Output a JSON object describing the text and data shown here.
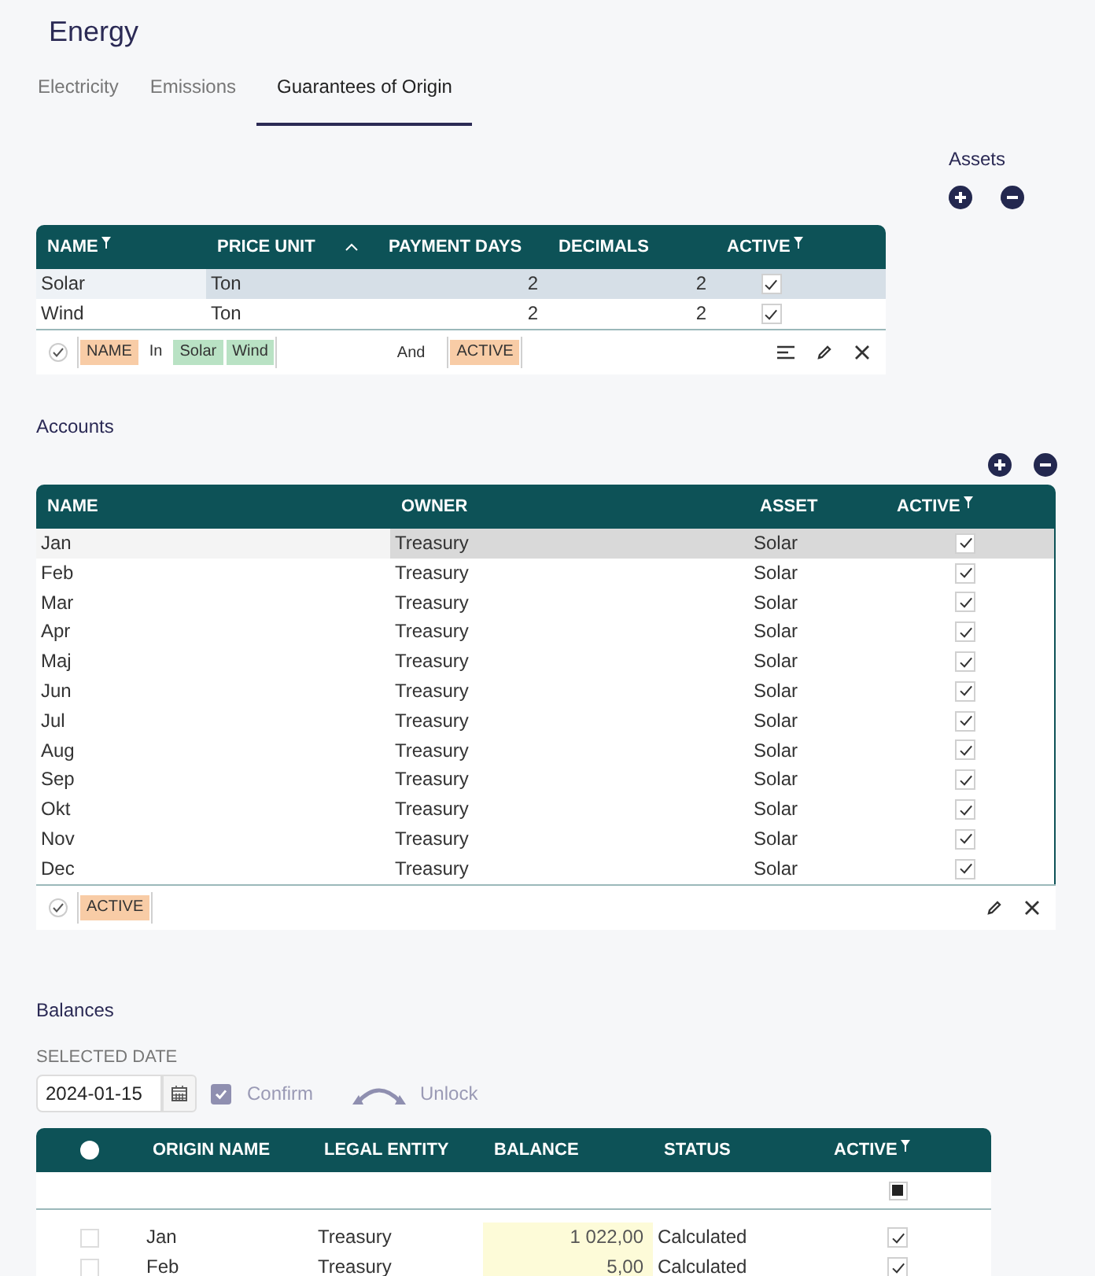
{
  "page_title": "Energy",
  "tabs": [
    {
      "label": "Electricity",
      "selected": false
    },
    {
      "label": "Emissions",
      "selected": false
    },
    {
      "label": "Guarantees of Origin",
      "selected": true
    }
  ],
  "assets": {
    "title": "Assets",
    "columns": [
      {
        "label": "NAME",
        "filter": true,
        "sorted": false
      },
      {
        "label": "PRICE UNIT",
        "filter": false,
        "sorted": true
      },
      {
        "label": "PAYMENT DAYS",
        "filter": false,
        "sorted": false
      },
      {
        "label": "DECIMALS",
        "filter": false,
        "sorted": false
      },
      {
        "label": "ACTIVE",
        "filter": true,
        "sorted": false
      }
    ],
    "rows": [
      {
        "cells": [
          "Solar",
          "Ton",
          "2",
          "2"
        ],
        "active": true,
        "selected": true
      },
      {
        "cells": [
          "Wind",
          "Ton",
          "2",
          "2"
        ],
        "active": true,
        "selected": false
      }
    ],
    "filter": {
      "enabled": true,
      "groups": [
        {
          "tokens": [
            {
              "kind": "field",
              "text": "NAME"
            },
            {
              "kind": "op",
              "text": "In"
            },
            {
              "kind": "value",
              "text": "Solar"
            },
            {
              "kind": "value",
              "text": "Wind"
            }
          ]
        },
        {
          "connector": "And",
          "tokens": [
            {
              "kind": "field",
              "text": "ACTIVE"
            }
          ]
        }
      ]
    }
  },
  "accounts": {
    "title": "Accounts",
    "columns": [
      {
        "label": "NAME",
        "filter": false,
        "sorted": false
      },
      {
        "label": "OWNER",
        "filter": false,
        "sorted": false
      },
      {
        "label": "ASSET",
        "filter": false,
        "sorted": false
      },
      {
        "label": "ACTIVE",
        "filter": true,
        "sorted": false
      }
    ],
    "rows": [
      {
        "cells": [
          "Jan",
          "Treasury",
          "Solar"
        ],
        "active": true,
        "selected": true
      },
      {
        "cells": [
          "Feb",
          "Treasury",
          "Solar"
        ],
        "active": true,
        "selected": false
      },
      {
        "cells": [
          "Mar",
          "Treasury",
          "Solar"
        ],
        "active": true,
        "selected": false
      },
      {
        "cells": [
          "Apr",
          "Treasury",
          "Solar"
        ],
        "active": true,
        "selected": false
      },
      {
        "cells": [
          "Maj",
          "Treasury",
          "Solar"
        ],
        "active": true,
        "selected": false
      },
      {
        "cells": [
          "Jun",
          "Treasury",
          "Solar"
        ],
        "active": true,
        "selected": false
      },
      {
        "cells": [
          "Jul",
          "Treasury",
          "Solar"
        ],
        "active": true,
        "selected": false
      },
      {
        "cells": [
          "Aug",
          "Treasury",
          "Solar"
        ],
        "active": true,
        "selected": false
      },
      {
        "cells": [
          "Sep",
          "Treasury",
          "Solar"
        ],
        "active": true,
        "selected": false
      },
      {
        "cells": [
          "Okt",
          "Treasury",
          "Solar"
        ],
        "active": true,
        "selected": false
      },
      {
        "cells": [
          "Nov",
          "Treasury",
          "Solar"
        ],
        "active": true,
        "selected": false
      },
      {
        "cells": [
          "Dec",
          "Treasury",
          "Solar"
        ],
        "active": true,
        "selected": false
      }
    ],
    "filter": {
      "enabled": true,
      "groups": [
        {
          "tokens": [
            {
              "kind": "field",
              "text": "ACTIVE"
            }
          ]
        }
      ]
    }
  },
  "balances": {
    "title": "Balances",
    "date_label": "SELECTED DATE",
    "date": "2024-01-15",
    "confirm": {
      "label": "Confirm",
      "checked": true,
      "disabled": true
    },
    "unlock": {
      "label": "Unlock",
      "disabled": true
    },
    "columns": [
      {
        "label": "ORIGIN NAME",
        "filter": false
      },
      {
        "label": "LEGAL ENTITY",
        "filter": false
      },
      {
        "label": "BALANCE",
        "filter": false
      },
      {
        "label": "STATUS",
        "filter": false
      },
      {
        "label": "ACTIVE",
        "filter": true
      }
    ],
    "all_selected": false,
    "active_filter_set": true,
    "rows": [
      {
        "cells": [
          "Jan",
          "Treasury",
          "1 022,00",
          "Calculated"
        ],
        "checked": false,
        "active": true
      },
      {
        "cells": [
          "Feb",
          "Treasury",
          "5,00",
          "Calculated"
        ],
        "checked": false,
        "active": true
      }
    ]
  }
}
